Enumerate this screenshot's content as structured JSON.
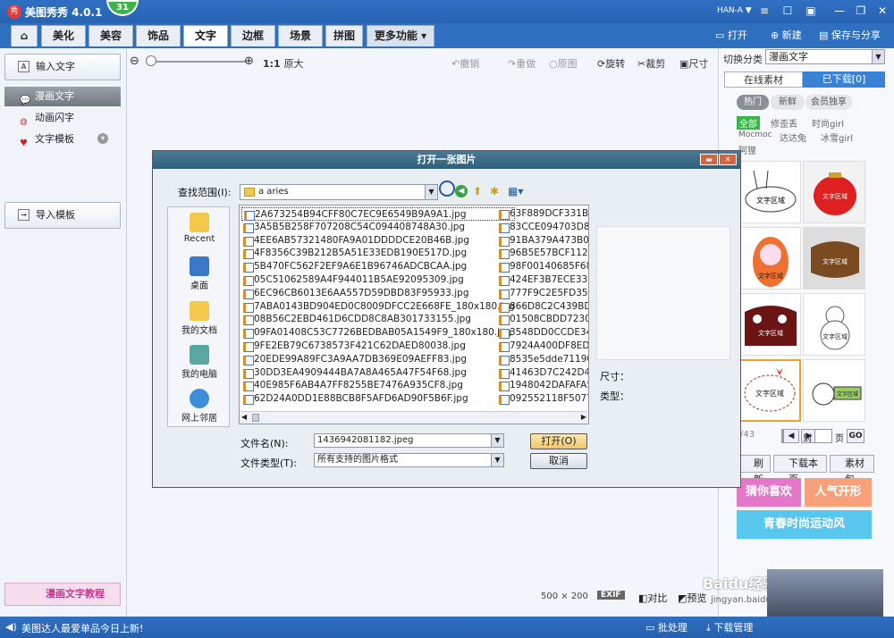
{
  "app": {
    "title": "美图秀秀 4.0.1",
    "logo_text": "秀",
    "badge": "31",
    "user": "HAN-A"
  },
  "tabs": [
    {
      "label": "美化"
    },
    {
      "label": "美容"
    },
    {
      "label": "饰品"
    },
    {
      "label": "文字"
    },
    {
      "label": "边框"
    },
    {
      "label": "场景"
    },
    {
      "label": "拼图"
    },
    {
      "label": "更多功能"
    }
  ],
  "header_buttons": {
    "open": "打开",
    "new": "新建",
    "save_share": "保存与分享"
  },
  "left": {
    "input_text": "输入文字",
    "comic_text": "漫画文字",
    "flash_text": "动画闪字",
    "text_template": "文字模板",
    "import_template": "导入模板",
    "tutorial": "漫画文字教程"
  },
  "toolbar": {
    "zoom_label": "1:1",
    "original_size": "原大",
    "undo": "撤销",
    "redo": "重做",
    "original": "原图",
    "rotate": "旋转",
    "crop": "裁剪",
    "size": "尺寸"
  },
  "right": {
    "switch_label": "切换分类",
    "category": "漫画文字",
    "tab_online": "在线素材",
    "tab_downloaded": "已下载[0]",
    "pill_hot": "热门",
    "pill_new": "新鲜",
    "pill_member": "会员独享",
    "tags_row1": [
      "全部",
      "修歪丢",
      "时尚girl"
    ],
    "tags_row2": [
      "Mocmoc",
      "达达兔",
      "冰雪girl"
    ],
    "tags_row3": [
      "阿狸"
    ],
    "sticker_text": "文字区域",
    "page_text": "/43",
    "goto_label": "到",
    "page_unit": "页",
    "go_button": "GO",
    "refresh": "刷新",
    "download_page": "下载本页",
    "material_pack": "素材包",
    "banner1": "猜你喜欢",
    "banner2": "人气开形",
    "banner3": "青春时尚运动风"
  },
  "status": {
    "message": "美图达人最爱单品今日上新!",
    "batch": "批处理",
    "download_manager": "下载管理",
    "dimensions": "500 × 200",
    "exif": "EXIF",
    "compare": "对比",
    "preview": "预览",
    "watermark": "jingyan.baidu.com",
    "baidu": "Baidu经验"
  },
  "dialog": {
    "title": "打开一张图片",
    "look_in_label": "查找范围(I):",
    "look_in_value": "a aries",
    "places": [
      "Recent",
      "桌面",
      "我的文档",
      "我的电脑",
      "网上邻居"
    ],
    "files_col1": [
      "2A673254B94CFF80C7EC9E6549B9A9A1.jpg",
      "3A5B5B258F707208C54C094408748A30.jpg",
      "4EE6AB57321480FA9A01DDDDCE20B46B.jpg",
      "4F8356C39B212B5A51E33EDB190E517D.jpg",
      "5B470FC562F2EF9A6E1B96746ADCBCAA.jpg",
      "05C51062589A4F944011B5AE92095309.jpg",
      "6EC96CB6013E6AA557D59DBD83F95933.jpg",
      "7ABA0143BD904ED0C8009DFCC2E668FE_180x180.jpg",
      "08B56C2EBD461D6CDD8C8AB301733155.jpg",
      "09FA01408C53C7726BEDBAB05A1549F9_180x180.jpg",
      "9FE2EB79C6738573F421C62DAED80038.jpg",
      "20EDE99A89FC3A9AA7DB369E09AEFF83.jpg",
      "30DD3EA4909444BA7A8A465A47F54F68.jpg",
      "40E985F6AB4A7FF8255BE7476A935CF8.jpg",
      "62D24A0DD1E88BCB8F5AFD6AD90F5B6F.jpg"
    ],
    "files_col2": [
      "63F889DCF331BA",
      "83CCE094703D85",
      "91BA379A473B00",
      "96B5E57BCF1127",
      "98F00140685F68",
      "424EF3B7ECE339",
      "777F9C2E5FD35A",
      "866D8C2C439BD5",
      "01508CBDD72306",
      "3548DD0CCDE347",
      "7924A400DF8ED0",
      "8535e5dde71190",
      "41463D7C242D46",
      "1948042DAFAFA5",
      "092552118F5077"
    ],
    "size_label": "尺寸：",
    "type_label": "类型：",
    "filename_label": "文件名(N):",
    "filename_value": "1436942081182.jpeg",
    "filetype_label": "文件类型(T):",
    "filetype_value": "所有支持的图片格式",
    "open_button": "打开(O)",
    "cancel_button": "取消"
  }
}
